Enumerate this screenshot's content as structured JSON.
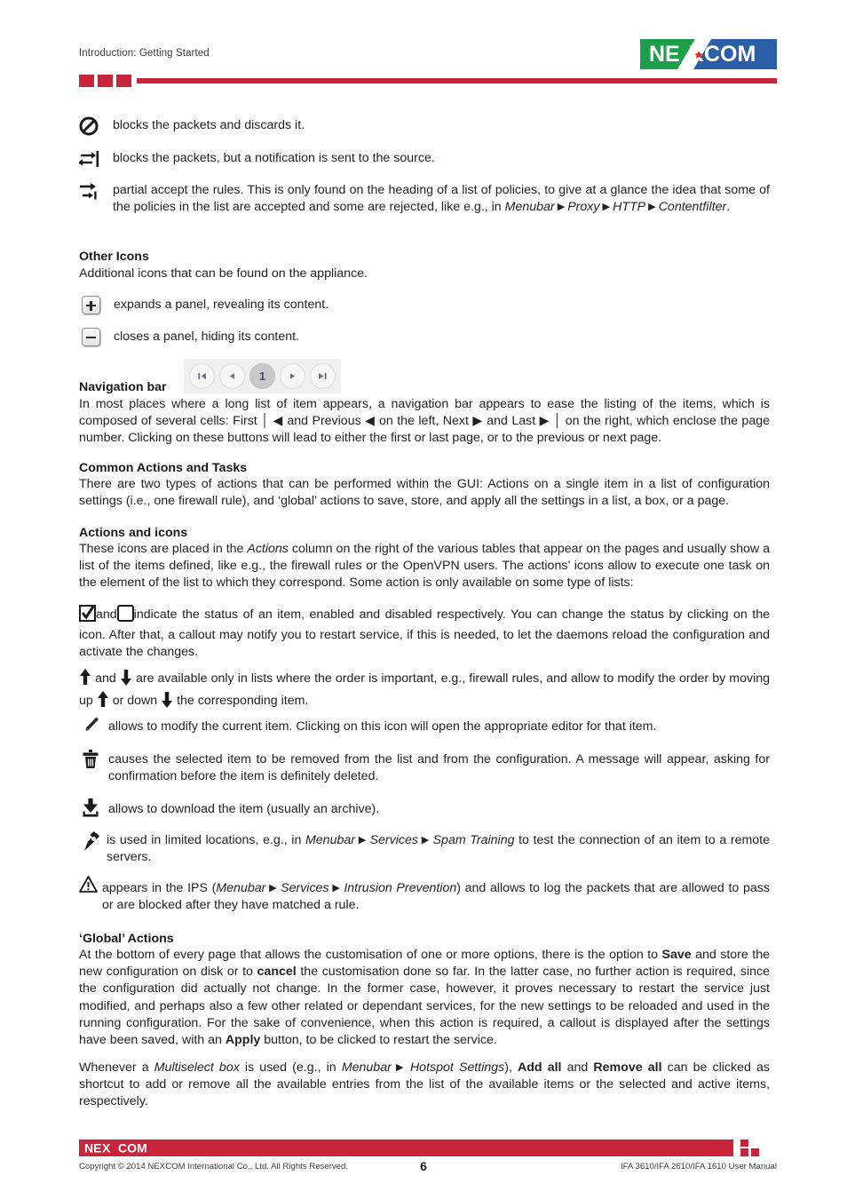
{
  "header": {
    "breadcrumb": "Introduction: Getting Started",
    "logo_text": "NEXCOM",
    "accent_color": "#c8253b"
  },
  "intro_icons": [
    {
      "icon": "no-entry-icon",
      "text": "blocks the packets and discards it."
    },
    {
      "icon": "reject-notify-icon",
      "text": "blocks the packets, but a notification is sent to the source."
    },
    {
      "icon": "partial-accept-icon",
      "text_line1": "partial accept the rules. This is only found on the heading of a list of policies, to give at a glance the idea",
      "text_line2_a": "that some  of the policies in the list are accepted and some are rejected, like e.g., in ",
      "text_line2_b": "Menubar",
      "text_line2_c": "Proxy",
      "text_line2_d": "HTTP",
      "text_line3_a": "Contentfilter",
      "text_line3_b": "."
    }
  ],
  "other_icons": {
    "heading": "Other Icons",
    "intro": "Additional icons that can be found on the appliance.",
    "items": [
      {
        "icon": "expand-panel-icon",
        "text": "expands a panel, revealing its content."
      },
      {
        "icon": "collapse-panel-icon",
        "text": "closes a panel, hiding its content."
      }
    ]
  },
  "navigation_bar": {
    "heading": "Navigation bar",
    "widget": {
      "first_label": "⏮",
      "prev_label": "◀",
      "page_label": "1",
      "next_label": "▶",
      "last_label": "⏭"
    },
    "para_line1": "In most places where a long list of item appears, a navigation bar appears to ease the listing of the items, which is",
    "para_line2": "composed of several cells: First │ ◀ and Previous ◀ on the left, Next ▶ and Last ▶ │ on the right, which enclose the page",
    "para_line3": "number. Clicking on these buttons will lead to either the first or last page, or to the previous or next page."
  },
  "common_actions": {
    "heading": "Common Actions and Tasks",
    "para": "There are two types of actions that can be performed within the GUI: Actions on a single item in a list of configuration settings (i.e., one firewall rule), and ‘global’ actions to save, store, and apply all the settings in a list, a box, or a page."
  },
  "actions_and_icons": {
    "heading": "Actions and icons",
    "para_a": "These icons are placed in the ",
    "para_b": "Actions",
    "para_c": " column on the right of the various tables that appear on the pages and usually show a list of the items defined, like e.g., the firewall rules or the OpenVPN users. The actions’ icons allow to execute one task on the element of the list to which they correspond. Some action is only available on some type of lists:",
    "checkbox_para_a": "and",
    "checkbox_para_b": "indicate the status of an item, enabled and disabled respectively. You can change the status by clicking on the icon. After that, a callout may notify you to restart service, if this is needed, to let the daemons reload the configuration and activate the changes.",
    "arrows_para_a": "and",
    "arrows_para_b": "are available only in lists where the order is important, e.g., firewall rules, and allow to modify the order by moving up",
    "arrows_para_c": "or down",
    "arrows_para_d": "the corresponding item.",
    "items": [
      {
        "icon": "pencil-edit-icon",
        "text": "allows to modify the current item. Clicking on this icon will open the appropriate editor for that item."
      },
      {
        "icon": "trash-delete-icon",
        "text": "causes the selected item to be removed from the list and from the configuration. A message will appear, asking for confirmation before the item is definitely deleted."
      },
      {
        "icon": "download-icon",
        "text": "allows to download the item (usually an archive)."
      },
      {
        "icon": "plug-connect-icon",
        "text_a": "is used in limited locations, e.g., in ",
        "text_b": "Menubar",
        "text_c": "Services",
        "text_d": "Spam Training",
        "text_e": " to test the connection of an item to a remote servers."
      },
      {
        "icon": "warning-triangle-icon",
        "text_a": "appears in the IPS (",
        "text_b": "Menubar",
        "text_c": "Services",
        "text_d": "Intrusion Prevention",
        "text_e": ") and allows to log the packets that are allowed to pass or are blocked after they have matched a rule."
      }
    ]
  },
  "global_actions": {
    "heading": "‘Global’ Actions",
    "p1_a": "At the bottom of every page that allows the customisation of one or more options, there is the option to ",
    "p1_save": "Save",
    "p1_b": " and store the new configuration on disk or to ",
    "p1_cancel": "cancel",
    "p1_c": " the customisation done so far. In the latter case, no further action is required, since the configuration did actually not change. In the former case, however, it proves necessary to restart the service just modified, and perhaps also a few other related or dependant services, for the new settings to be reloaded and used in the running configuration. For the sake of convenience, when this action is required, a callout is displayed after the settings have been saved, with an ",
    "p1_apply": "Apply",
    "p1_d": " button, to be clicked to restart the service.",
    "p2_a": "Whenever a ",
    "p2_multiselect": "Multiselect box",
    "p2_b": " is used (e.g., in ",
    "p2_menubar": "Menubar",
    "p2_hotspot": "Hotspot Settings",
    "p2_c": "), ",
    "p2_addall": "Add all",
    "p2_d": " and ",
    "p2_removeall": "Remove all",
    "p2_e": " can be clicked as shortcut to add or remove all the available entries from the list of the available items or the selected and active items, respectively."
  },
  "footer": {
    "logo_text": "NEXCOM",
    "copyright": "Copyright © 2014 NEXCOM International Co., Ltd. All Rights Reserved.",
    "page_number": "6",
    "manual": "IFA 3610/IFA 2610/IFA 1610 User Manual"
  }
}
